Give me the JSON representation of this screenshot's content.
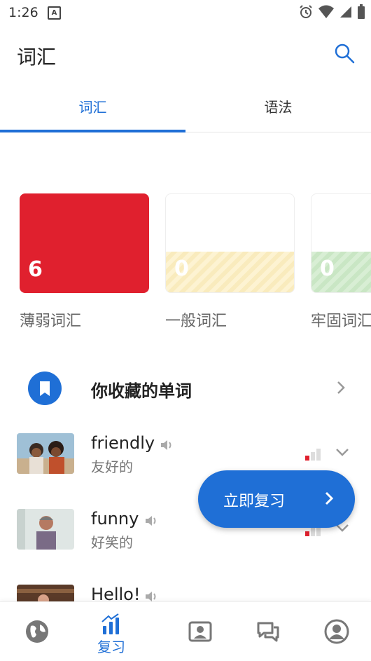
{
  "status_bar": {
    "time": "1:26",
    "notification_icon": "A-icon",
    "icons": [
      "alarm-icon",
      "wifi-icon",
      "signal-icon",
      "battery-icon"
    ]
  },
  "header": {
    "title": "词汇",
    "search_icon": "search-icon"
  },
  "tabs": [
    {
      "label": "词汇",
      "active": true
    },
    {
      "label": "语法",
      "active": false
    }
  ],
  "strength_cards": [
    {
      "label": "薄弱词汇",
      "count": "6",
      "color": "#e0202e"
    },
    {
      "label": "一般词汇",
      "count": "0",
      "color": "#f9ebbd"
    },
    {
      "label": "牢固词汇",
      "count": "0",
      "color": "#c9e6c4"
    }
  ],
  "saved_words": {
    "label": "你收藏的单词"
  },
  "words": [
    {
      "english": "friendly",
      "chinese": "友好的",
      "strength_level": 1
    },
    {
      "english": "funny",
      "chinese": "好笑的",
      "strength_level": 1
    },
    {
      "english": "Hello!",
      "chinese": "",
      "strength_level": 1
    }
  ],
  "fab": {
    "label": "立即复习"
  },
  "bottom_nav": [
    {
      "name": "globe-icon",
      "label": ""
    },
    {
      "name": "review-chart-icon",
      "label": "复习",
      "active": true
    },
    {
      "name": "profile-card-icon",
      "label": ""
    },
    {
      "name": "chat-icon",
      "label": ""
    },
    {
      "name": "account-icon",
      "label": ""
    }
  ],
  "colors": {
    "accent": "#1f6fd6",
    "weak": "#e0202e"
  }
}
